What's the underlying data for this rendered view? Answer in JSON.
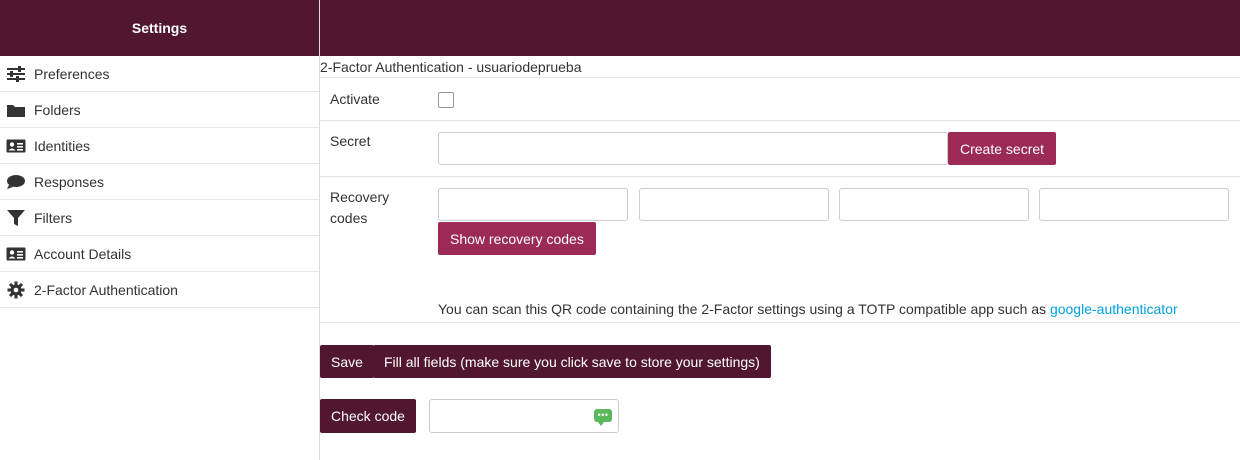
{
  "sidebar": {
    "title": "Settings",
    "items": [
      {
        "label": "Preferences",
        "icon": "sliders-icon"
      },
      {
        "label": "Folders",
        "icon": "folder-icon"
      },
      {
        "label": "Identities",
        "icon": "id-card-icon"
      },
      {
        "label": "Responses",
        "icon": "comment-icon"
      },
      {
        "label": "Filters",
        "icon": "filter-icon"
      },
      {
        "label": "Account Details",
        "icon": "id-card-icon"
      },
      {
        "label": "2-Factor Authentication",
        "icon": "gear-icon"
      }
    ]
  },
  "main": {
    "title": "2-Factor Authentication - usuariodeprueba",
    "activate_label": "Activate",
    "activate_checked": false,
    "secret_label": "Secret",
    "secret_value": "",
    "create_secret_button": "Create secret",
    "recovery_label_line1": "Recovery",
    "recovery_label_line2": "codes",
    "recovery_codes": [
      "",
      "",
      "",
      ""
    ],
    "show_recovery_button": "Show recovery codes",
    "qr_text": "You can scan this QR code containing the 2-Factor settings using a TOTP compatible app such as ",
    "qr_link": "google-authenticator",
    "save_button": "Save",
    "fill_all_button": "Fill all fields (make sure you click save to store your settings)",
    "check_code_button": "Check code",
    "check_code_value": ""
  },
  "colors": {
    "header": "#511730",
    "accent_button": "#9b2a57",
    "link": "#00a0dd",
    "code_icon": "#5cb85c"
  }
}
